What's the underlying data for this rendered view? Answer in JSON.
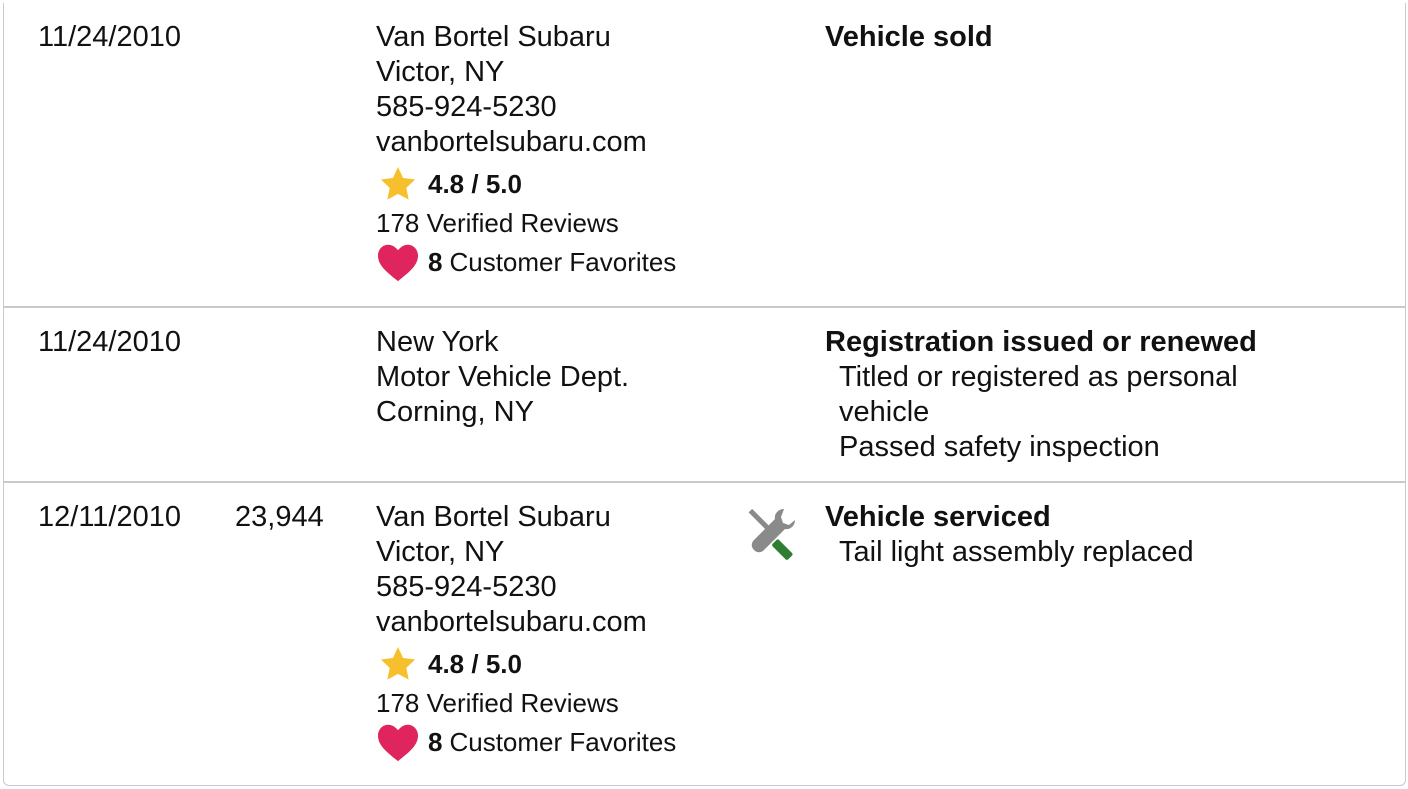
{
  "records": [
    {
      "date": "11/24/2010",
      "mileage": "",
      "source": {
        "name": "Van Bortel Subaru",
        "location": "Victor, NY",
        "phone": "585-924-5230",
        "website": "vanbortelsubaru.com",
        "rating": "4.8 / 5.0",
        "reviews": "178 Verified Reviews",
        "favorites_count": "8",
        "favorites_label": "Customer Favorites"
      },
      "icon": "",
      "comment_title": "Vehicle sold",
      "comment_details": []
    },
    {
      "date": "11/24/2010",
      "mileage": "",
      "source": {
        "line1": "New York",
        "line2": "Motor Vehicle Dept.",
        "line3": "Corning, NY"
      },
      "icon": "",
      "comment_title": "Registration issued or renewed",
      "comment_details": [
        "Titled or registered as personal vehicle",
        "Passed safety inspection"
      ]
    },
    {
      "date": "12/11/2010",
      "mileage": "23,944",
      "source": {
        "name": "Van Bortel Subaru",
        "location": "Victor, NY",
        "phone": "585-924-5230",
        "website": "vanbortelsubaru.com",
        "rating": "4.8 / 5.0",
        "reviews": "178 Verified Reviews",
        "favorites_count": "8",
        "favorites_label": "Customer Favorites"
      },
      "icon": "wrench-screwdriver-icon",
      "comment_title": "Vehicle serviced",
      "comment_details": [
        "Tail light assembly replaced"
      ]
    }
  ],
  "colors": {
    "star": "#F6C02C",
    "heart": "#E0245E",
    "wrench": "#8A8A8A",
    "screwdriver_handle": "#2E7D32",
    "border": "#C9C9C9"
  }
}
